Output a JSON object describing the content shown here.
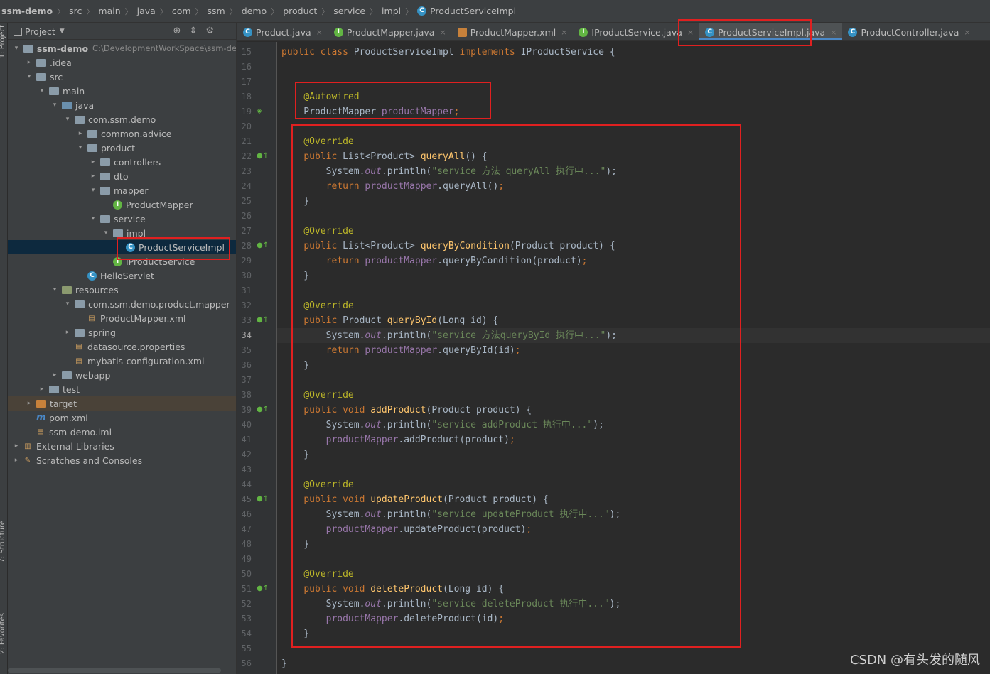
{
  "breadcrumb": [
    "ssm-demo",
    "src",
    "main",
    "java",
    "com",
    "ssm",
    "demo",
    "product",
    "service",
    "impl",
    "ProductServiceImpl"
  ],
  "project_panel": {
    "title": "Project",
    "tree": [
      {
        "label": "ssm-demo",
        "path": "C:\\DevelopmentWorkSpace\\ssm-de",
        "depth": 0,
        "arrow": "▾",
        "icon": "module-folder",
        "bold": true
      },
      {
        "label": ".idea",
        "depth": 1,
        "arrow": "▸",
        "icon": "folder"
      },
      {
        "label": "src",
        "depth": 1,
        "arrow": "▾",
        "icon": "folder"
      },
      {
        "label": "main",
        "depth": 2,
        "arrow": "▾",
        "icon": "folder"
      },
      {
        "label": "java",
        "depth": 3,
        "arrow": "▾",
        "icon": "source-folder"
      },
      {
        "label": "com.ssm.demo",
        "depth": 4,
        "arrow": "▾",
        "icon": "package"
      },
      {
        "label": "common.advice",
        "depth": 5,
        "arrow": "▸",
        "icon": "package"
      },
      {
        "label": "product",
        "depth": 5,
        "arrow": "▾",
        "icon": "package"
      },
      {
        "label": "controllers",
        "depth": 6,
        "arrow": "▸",
        "icon": "package"
      },
      {
        "label": "dto",
        "depth": 6,
        "arrow": "▸",
        "icon": "package"
      },
      {
        "label": "mapper",
        "depth": 6,
        "arrow": "▾",
        "icon": "package"
      },
      {
        "label": "ProductMapper",
        "depth": 7,
        "arrow": "",
        "icon": "interface"
      },
      {
        "label": "service",
        "depth": 6,
        "arrow": "▾",
        "icon": "package"
      },
      {
        "label": "impl",
        "depth": 7,
        "arrow": "▾",
        "icon": "package"
      },
      {
        "label": "ProductServiceImpl",
        "depth": 8,
        "arrow": "",
        "icon": "class",
        "selected": true
      },
      {
        "label": "IProductService",
        "depth": 7,
        "arrow": "",
        "icon": "interface"
      },
      {
        "label": "HelloServlet",
        "depth": 5,
        "arrow": "",
        "icon": "class"
      },
      {
        "label": "resources",
        "depth": 3,
        "arrow": "▾",
        "icon": "resource-folder"
      },
      {
        "label": "com.ssm.demo.product.mapper",
        "depth": 4,
        "arrow": "▾",
        "icon": "folder"
      },
      {
        "label": "ProductMapper.xml",
        "depth": 5,
        "arrow": "",
        "icon": "xml-file"
      },
      {
        "label": "spring",
        "depth": 4,
        "arrow": "▸",
        "icon": "folder"
      },
      {
        "label": "datasource.properties",
        "depth": 4,
        "arrow": "",
        "icon": "properties-file"
      },
      {
        "label": "mybatis-configuration.xml",
        "depth": 4,
        "arrow": "",
        "icon": "xml-file"
      },
      {
        "label": "webapp",
        "depth": 3,
        "arrow": "▸",
        "icon": "web-folder"
      },
      {
        "label": "test",
        "depth": 2,
        "arrow": "▸",
        "icon": "folder"
      },
      {
        "label": "target",
        "depth": 1,
        "arrow": "▸",
        "icon": "excluded-folder",
        "highlight": true
      },
      {
        "label": "pom.xml",
        "depth": 1,
        "arrow": "",
        "icon": "maven-file"
      },
      {
        "label": "ssm-demo.iml",
        "depth": 1,
        "arrow": "",
        "icon": "iml-file"
      },
      {
        "label": "External Libraries",
        "depth": 0,
        "arrow": "▸",
        "icon": "libraries"
      },
      {
        "label": "Scratches and Consoles",
        "depth": 0,
        "arrow": "▸",
        "icon": "scratches"
      }
    ]
  },
  "side_tabs": [
    "1: Project",
    "7: Structure",
    "2: Favorites"
  ],
  "tabs": [
    {
      "label": "Product.java",
      "icon": "class"
    },
    {
      "label": "ProductMapper.java",
      "icon": "interface"
    },
    {
      "label": "ProductMapper.xml",
      "icon": "xml"
    },
    {
      "label": "IProductService.java",
      "icon": "interface"
    },
    {
      "label": "ProductServiceImpl.java",
      "icon": "class",
      "active": true
    },
    {
      "label": "ProductController.java",
      "icon": "class"
    }
  ],
  "editor": {
    "first_line": 15,
    "current_line": 34,
    "lines": [
      [
        [
          "kw",
          "public class "
        ],
        [
          "",
          "ProductServiceImpl "
        ],
        [
          "kw",
          "implements "
        ],
        [
          "",
          "IProductService {"
        ]
      ],
      [],
      [],
      [
        [
          "",
          "    "
        ],
        [
          "ann",
          "@Autowired"
        ]
      ],
      [
        [
          "",
          "    ProductMapper "
        ],
        [
          "fld",
          "productMapper"
        ],
        [
          "kw",
          ";"
        ]
      ],
      [],
      [
        [
          "",
          "    "
        ],
        [
          "ann",
          "@Override"
        ]
      ],
      [
        [
          "",
          "    "
        ],
        [
          "kw",
          "public "
        ],
        [
          "",
          "List<Product> "
        ],
        [
          "mth",
          "queryAll"
        ],
        [
          "",
          "() {"
        ]
      ],
      [
        [
          "",
          "        System."
        ],
        [
          "fld ital",
          "out"
        ],
        [
          "",
          ".println("
        ],
        [
          "str",
          "\"service 方法 queryAll 执行中...\""
        ],
        [
          "",
          "); "
        ]
      ],
      [
        [
          "",
          "        "
        ],
        [
          "kw",
          "return "
        ],
        [
          "fld",
          "productMapper"
        ],
        [
          "",
          ".queryAll()"
        ],
        [
          "kw",
          ";"
        ]
      ],
      [
        [
          "",
          "    }"
        ]
      ],
      [],
      [
        [
          "",
          "    "
        ],
        [
          "ann",
          "@Override"
        ]
      ],
      [
        [
          "",
          "    "
        ],
        [
          "kw",
          "public "
        ],
        [
          "",
          "List<Product> "
        ],
        [
          "mth",
          "queryByCondition"
        ],
        [
          "",
          "(Product product) {"
        ]
      ],
      [
        [
          "",
          "        "
        ],
        [
          "kw",
          "return "
        ],
        [
          "fld",
          "productMapper"
        ],
        [
          "",
          ".queryByCondition(product)"
        ],
        [
          "kw",
          ";"
        ]
      ],
      [
        [
          "",
          "    }"
        ]
      ],
      [],
      [
        [
          "",
          "    "
        ],
        [
          "ann",
          "@Override"
        ]
      ],
      [
        [
          "",
          "    "
        ],
        [
          "kw",
          "public "
        ],
        [
          "",
          "Product "
        ],
        [
          "mth",
          "queryById"
        ],
        [
          "",
          "(Long id) {"
        ]
      ],
      [
        [
          "",
          "        System."
        ],
        [
          "fld ital",
          "out"
        ],
        [
          "",
          ".println("
        ],
        [
          "str",
          "\"service 方法queryById 执行中...\""
        ],
        [
          "",
          ");"
        ]
      ],
      [
        [
          "",
          "        "
        ],
        [
          "kw",
          "return "
        ],
        [
          "fld",
          "productMapper"
        ],
        [
          "",
          ".queryById(id)"
        ],
        [
          "kw",
          ";"
        ]
      ],
      [
        [
          "",
          "    }"
        ]
      ],
      [],
      [
        [
          "",
          "    "
        ],
        [
          "ann",
          "@Override"
        ]
      ],
      [
        [
          "",
          "    "
        ],
        [
          "kw",
          "public void "
        ],
        [
          "mth",
          "addProduct"
        ],
        [
          "",
          "(Product product) {"
        ]
      ],
      [
        [
          "",
          "        System."
        ],
        [
          "fld ital",
          "out"
        ],
        [
          "",
          ".println("
        ],
        [
          "str",
          "\"service addProduct 执行中...\""
        ],
        [
          "",
          ");"
        ]
      ],
      [
        [
          "",
          "        "
        ],
        [
          "fld",
          "productMapper"
        ],
        [
          "",
          ".addProduct(product)"
        ],
        [
          "kw",
          ";"
        ]
      ],
      [
        [
          "",
          "    }"
        ]
      ],
      [],
      [
        [
          "",
          "    "
        ],
        [
          "ann",
          "@Override"
        ]
      ],
      [
        [
          "",
          "    "
        ],
        [
          "kw",
          "public void "
        ],
        [
          "mth",
          "updateProduct"
        ],
        [
          "",
          "(Product product) {"
        ]
      ],
      [
        [
          "",
          "        System."
        ],
        [
          "fld ital",
          "out"
        ],
        [
          "",
          ".println("
        ],
        [
          "str",
          "\"service updateProduct 执行中...\""
        ],
        [
          "",
          ");"
        ]
      ],
      [
        [
          "",
          "        "
        ],
        [
          "fld",
          "productMapper"
        ],
        [
          "",
          ".updateProduct(product)"
        ],
        [
          "kw",
          ";"
        ]
      ],
      [
        [
          "",
          "    }"
        ]
      ],
      [],
      [
        [
          "",
          "    "
        ],
        [
          "ann",
          "@Override"
        ]
      ],
      [
        [
          "",
          "    "
        ],
        [
          "kw",
          "public void "
        ],
        [
          "mth",
          "deleteProduct"
        ],
        [
          "",
          "(Long id) {"
        ]
      ],
      [
        [
          "",
          "        System."
        ],
        [
          "fld ital",
          "out"
        ],
        [
          "",
          ".println("
        ],
        [
          "str",
          "\"service deleteProduct 执行中...\""
        ],
        [
          "",
          ");"
        ]
      ],
      [
        [
          "",
          "        "
        ],
        [
          "fld",
          "productMapper"
        ],
        [
          "",
          ".deleteProduct(id)"
        ],
        [
          "kw",
          ";"
        ]
      ],
      [
        [
          "",
          "    }"
        ]
      ],
      [],
      [
        [
          "",
          "}"
        ]
      ]
    ],
    "gutter_marks": [
      19,
      22,
      28,
      33,
      39,
      45,
      51
    ]
  },
  "watermark": "CSDN @有头发的随风",
  "colors": {
    "highlight_box": "#e02020",
    "active_tab_underline": "#4a88c7"
  }
}
